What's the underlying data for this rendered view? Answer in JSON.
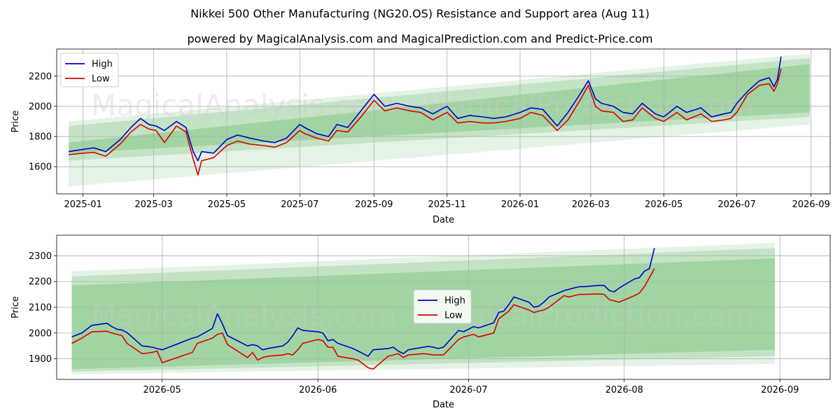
{
  "header": {
    "title": "Nikkei 500 Other Manufacturing (NG20.OS) Resistance and Support area (Aug 11)",
    "subtitle": "powered by MagicalAnalysis.com and MagicalPrediction.com and Predict-Price.com"
  },
  "watermarks": [
    "MagicalAnalysis.com",
    "MagicalPrediction.com"
  ],
  "colors": {
    "high": "#0000cc",
    "low": "#dd0000",
    "band": "#4caf50",
    "grid": "#b0b0b0"
  },
  "chart_data": [
    {
      "type": "line",
      "xlabel": "Date",
      "ylabel": "Price",
      "xlim": [
        "2024-12-10",
        "2026-09-17"
      ],
      "ylim": [
        1420,
        2380
      ],
      "grid": true,
      "legend": "top-left",
      "x_ticks": [
        "2025-01-01",
        "2025-03-01",
        "2025-05-01",
        "2025-07-01",
        "2025-09-01",
        "2025-11-01",
        "2026-01-01",
        "2026-03-01",
        "2026-05-01",
        "2026-07-01",
        "2026-09-01"
      ],
      "x_tick_labels": [
        "2025-01",
        "2025-03",
        "2025-05",
        "2025-07",
        "2025-09",
        "2025-11",
        "2026-01",
        "2026-03",
        "2026-05",
        "2026-07",
        "2026-09"
      ],
      "y_ticks": [
        1600,
        1800,
        2000,
        2200
      ],
      "bands": [
        {
          "start": "2024-12-20",
          "end": "2026-08-31",
          "lower": [
            1470,
            1880
          ],
          "upper": [
            1900,
            2350
          ]
        },
        {
          "start": "2024-12-20",
          "end": "2026-08-31",
          "lower": [
            1640,
            1930
          ],
          "upper": [
            1870,
            2320
          ]
        },
        {
          "start": "2024-12-20",
          "end": "2026-08-31",
          "lower": [
            1690,
            1960
          ],
          "upper": [
            1760,
            2280
          ]
        }
      ],
      "series": [
        {
          "name": "High",
          "color": "#0000cc",
          "x": [
            "2024-12-20",
            "2025-01-01",
            "2025-01-10",
            "2025-01-20",
            "2025-02-01",
            "2025-02-10",
            "2025-02-18",
            "2025-02-25",
            "2025-03-03",
            "2025-03-10",
            "2025-03-20",
            "2025-03-28",
            "2025-04-03",
            "2025-04-07",
            "2025-04-10",
            "2025-04-20",
            "2025-05-01",
            "2025-05-10",
            "2025-05-20",
            "2025-06-01",
            "2025-06-10",
            "2025-06-20",
            "2025-07-01",
            "2025-07-05",
            "2025-07-15",
            "2025-07-25",
            "2025-08-01",
            "2025-08-10",
            "2025-08-20",
            "2025-09-01",
            "2025-09-10",
            "2025-09-20",
            "2025-10-01",
            "2025-10-10",
            "2025-10-20",
            "2025-11-01",
            "2025-11-10",
            "2025-11-20",
            "2025-12-01",
            "2025-12-10",
            "2025-12-20",
            "2026-01-01",
            "2026-01-10",
            "2026-01-20",
            "2026-02-01",
            "2026-02-10",
            "2026-02-20",
            "2026-02-27",
            "2026-03-05",
            "2026-03-10",
            "2026-03-20",
            "2026-03-28",
            "2026-04-05",
            "2026-04-13",
            "2026-04-24",
            "2026-05-01",
            "2026-05-12",
            "2026-05-20",
            "2026-06-01",
            "2026-06-10",
            "2026-06-20",
            "2026-06-26",
            "2026-07-01",
            "2026-07-10",
            "2026-07-20",
            "2026-07-28",
            "2026-08-01",
            "2026-08-04",
            "2026-08-07"
          ],
          "y": [
            1700,
            1715,
            1725,
            1700,
            1780,
            1860,
            1920,
            1880,
            1870,
            1840,
            1900,
            1860,
            1700,
            1640,
            1700,
            1690,
            1780,
            1810,
            1790,
            1770,
            1760,
            1790,
            1880,
            1860,
            1820,
            1800,
            1880,
            1860,
            1960,
            2080,
            2000,
            2020,
            2000,
            1990,
            1950,
            2000,
            1920,
            1940,
            1930,
            1920,
            1930,
            1960,
            1990,
            1980,
            1870,
            1960,
            2080,
            2170,
            2050,
            2020,
            2000,
            1960,
            1950,
            2020,
            1950,
            1930,
            2000,
            1960,
            1990,
            1930,
            1950,
            1960,
            2020,
            2100,
            2170,
            2190,
            2130,
            2180,
            2330
          ]
        },
        {
          "name": "Low",
          "color": "#dd0000",
          "x": [
            "2024-12-20",
            "2025-01-01",
            "2025-01-10",
            "2025-01-20",
            "2025-02-01",
            "2025-02-10",
            "2025-02-18",
            "2025-02-25",
            "2025-03-03",
            "2025-03-10",
            "2025-03-20",
            "2025-03-28",
            "2025-04-03",
            "2025-04-07",
            "2025-04-10",
            "2025-04-20",
            "2025-05-01",
            "2025-05-10",
            "2025-05-20",
            "2025-06-01",
            "2025-06-10",
            "2025-06-20",
            "2025-07-01",
            "2025-07-05",
            "2025-07-15",
            "2025-07-25",
            "2025-08-01",
            "2025-08-10",
            "2025-08-20",
            "2025-09-01",
            "2025-09-10",
            "2025-09-20",
            "2025-10-01",
            "2025-10-10",
            "2025-10-20",
            "2025-11-01",
            "2025-11-10",
            "2025-11-20",
            "2025-12-01",
            "2025-12-10",
            "2025-12-20",
            "2026-01-01",
            "2026-01-10",
            "2026-01-20",
            "2026-02-01",
            "2026-02-10",
            "2026-02-20",
            "2026-02-27",
            "2026-03-05",
            "2026-03-10",
            "2026-03-20",
            "2026-03-28",
            "2026-04-05",
            "2026-04-13",
            "2026-04-24",
            "2026-05-01",
            "2026-05-12",
            "2026-05-20",
            "2026-06-01",
            "2026-06-10",
            "2026-06-20",
            "2026-06-26",
            "2026-07-01",
            "2026-07-10",
            "2026-07-20",
            "2026-07-28",
            "2026-08-01",
            "2026-08-04",
            "2026-08-07"
          ],
          "y": [
            1680,
            1690,
            1695,
            1670,
            1750,
            1830,
            1880,
            1850,
            1840,
            1760,
            1870,
            1830,
            1650,
            1545,
            1640,
            1660,
            1740,
            1770,
            1750,
            1740,
            1730,
            1760,
            1840,
            1820,
            1790,
            1770,
            1840,
            1830,
            1920,
            2040,
            1970,
            1990,
            1970,
            1960,
            1910,
            1960,
            1890,
            1900,
            1890,
            1890,
            1900,
            1920,
            1960,
            1940,
            1840,
            1910,
            2040,
            2140,
            2000,
            1970,
            1960,
            1900,
            1910,
            1990,
            1920,
            1900,
            1960,
            1910,
            1950,
            1900,
            1910,
            1920,
            1960,
            2080,
            2140,
            2150,
            2100,
            2150,
            2250
          ]
        }
      ]
    },
    {
      "type": "line",
      "xlabel": "Date",
      "ylabel": "Price",
      "xlim": [
        "2026-04-10",
        "2026-09-11"
      ],
      "ylim": [
        1820,
        2380
      ],
      "grid": true,
      "legend": "center",
      "x_ticks": [
        "2026-05-01",
        "2026-06-01",
        "2026-07-01",
        "2026-08-01",
        "2026-09-01"
      ],
      "x_tick_labels": [
        "2026-05",
        "2026-06",
        "2026-07",
        "2026-08",
        "2026-09"
      ],
      "y_ticks": [
        1900,
        2000,
        2100,
        2200,
        2300
      ],
      "bands": [
        {
          "start": "2026-04-13",
          "end": "2026-08-31",
          "lower": [
            1840,
            1880
          ],
          "upper": [
            2240,
            2350
          ]
        },
        {
          "start": "2026-04-13",
          "end": "2026-08-31",
          "lower": [
            1850,
            1910
          ],
          "upper": [
            2220,
            2330
          ]
        },
        {
          "start": "2026-04-13",
          "end": "2026-08-31",
          "lower": [
            1860,
            1935
          ],
          "upper": [
            2185,
            2290
          ]
        }
      ],
      "series": [
        {
          "name": "High",
          "color": "#0000cc",
          "x": [
            "2026-04-13",
            "2026-04-15",
            "2026-04-17",
            "2026-04-20",
            "2026-04-21",
            "2026-04-22",
            "2026-04-23",
            "2026-04-24",
            "2026-04-27",
            "2026-04-28",
            "2026-04-29",
            "2026-04-30",
            "2026-05-01",
            "2026-05-07",
            "2026-05-08",
            "2026-05-11",
            "2026-05-12",
            "2026-05-13",
            "2026-05-14",
            "2026-05-18",
            "2026-05-19",
            "2026-05-20",
            "2026-05-21",
            "2026-05-22",
            "2026-05-25",
            "2026-05-26",
            "2026-05-27",
            "2026-05-28",
            "2026-05-29",
            "2026-06-01",
            "2026-06-02",
            "2026-06-03",
            "2026-06-04",
            "2026-06-05",
            "2026-06-08",
            "2026-06-09",
            "2026-06-10",
            "2026-06-11",
            "2026-06-12",
            "2026-06-15",
            "2026-06-16",
            "2026-06-17",
            "2026-06-18",
            "2026-06-19",
            "2026-06-22",
            "2026-06-23",
            "2026-06-24",
            "2026-06-25",
            "2026-06-26",
            "2026-06-29",
            "2026-06-30",
            "2026-07-01",
            "2026-07-02",
            "2026-07-03",
            "2026-07-06",
            "2026-07-07",
            "2026-07-08",
            "2026-07-09",
            "2026-07-10",
            "2026-07-13",
            "2026-07-14",
            "2026-07-15",
            "2026-07-16",
            "2026-07-17",
            "2026-07-20",
            "2026-07-21",
            "2026-07-22",
            "2026-07-23",
            "2026-07-24",
            "2026-07-27",
            "2026-07-28",
            "2026-07-29",
            "2026-07-30",
            "2026-07-31",
            "2026-08-03",
            "2026-08-04",
            "2026-08-05",
            "2026-08-06",
            "2026-08-07"
          ],
          "y": [
            1985,
            2000,
            2030,
            2038,
            2025,
            2015,
            2012,
            2002,
            1950,
            1948,
            1945,
            1940,
            1935,
            1980,
            1985,
            2018,
            2075,
            2035,
            1990,
            1950,
            1955,
            1950,
            1935,
            1940,
            1950,
            1965,
            1990,
            2020,
            2010,
            2005,
            2000,
            1970,
            1975,
            1960,
            1940,
            1930,
            1920,
            1910,
            1935,
            1940,
            1945,
            1930,
            1920,
            1935,
            1945,
            1948,
            1945,
            1940,
            1945,
            2010,
            2005,
            2015,
            2025,
            2020,
            2040,
            2080,
            2085,
            2110,
            2140,
            2120,
            2100,
            2105,
            2120,
            2140,
            2165,
            2170,
            2175,
            2180,
            2180,
            2185,
            2185,
            2165,
            2160,
            2175,
            2210,
            2215,
            2240,
            2250,
            2330
          ]
        },
        {
          "name": "Low",
          "color": "#dd0000",
          "x": [
            "2026-04-13",
            "2026-04-15",
            "2026-04-17",
            "2026-04-20",
            "2026-04-21",
            "2026-04-22",
            "2026-04-23",
            "2026-04-24",
            "2026-04-27",
            "2026-04-28",
            "2026-04-29",
            "2026-04-30",
            "2026-05-01",
            "2026-05-07",
            "2026-05-08",
            "2026-05-11",
            "2026-05-12",
            "2026-05-13",
            "2026-05-14",
            "2026-05-18",
            "2026-05-19",
            "2026-05-20",
            "2026-05-21",
            "2026-05-22",
            "2026-05-25",
            "2026-05-26",
            "2026-05-27",
            "2026-05-28",
            "2026-05-29",
            "2026-06-01",
            "2026-06-02",
            "2026-06-03",
            "2026-06-04",
            "2026-06-05",
            "2026-06-08",
            "2026-06-09",
            "2026-06-10",
            "2026-06-11",
            "2026-06-12",
            "2026-06-15",
            "2026-06-16",
            "2026-06-17",
            "2026-06-18",
            "2026-06-19",
            "2026-06-22",
            "2026-06-23",
            "2026-06-24",
            "2026-06-25",
            "2026-06-26",
            "2026-06-29",
            "2026-06-30",
            "2026-07-01",
            "2026-07-02",
            "2026-07-03",
            "2026-07-06",
            "2026-07-07",
            "2026-07-08",
            "2026-07-09",
            "2026-07-10",
            "2026-07-13",
            "2026-07-14",
            "2026-07-15",
            "2026-07-16",
            "2026-07-17",
            "2026-07-20",
            "2026-07-21",
            "2026-07-22",
            "2026-07-23",
            "2026-07-24",
            "2026-07-27",
            "2026-07-28",
            "2026-07-29",
            "2026-07-30",
            "2026-07-31",
            "2026-08-03",
            "2026-08-04",
            "2026-08-05",
            "2026-08-06",
            "2026-08-07"
          ],
          "y": [
            1960,
            1980,
            2005,
            2007,
            2000,
            1995,
            1990,
            1960,
            1920,
            1922,
            1925,
            1930,
            1885,
            1925,
            1960,
            1980,
            1995,
            2000,
            1955,
            1905,
            1925,
            1895,
            1905,
            1910,
            1915,
            1920,
            1915,
            1935,
            1960,
            1975,
            1970,
            1945,
            1945,
            1910,
            1900,
            1895,
            1880,
            1865,
            1860,
            1910,
            1915,
            1920,
            1905,
            1915,
            1920,
            1918,
            1915,
            1915,
            1915,
            1975,
            1985,
            1990,
            1995,
            1985,
            2000,
            2055,
            2070,
            2085,
            2110,
            2090,
            2080,
            2085,
            2090,
            2100,
            2145,
            2140,
            2145,
            2150,
            2150,
            2152,
            2150,
            2130,
            2125,
            2120,
            2145,
            2155,
            2180,
            2215,
            2250
          ]
        }
      ]
    }
  ]
}
